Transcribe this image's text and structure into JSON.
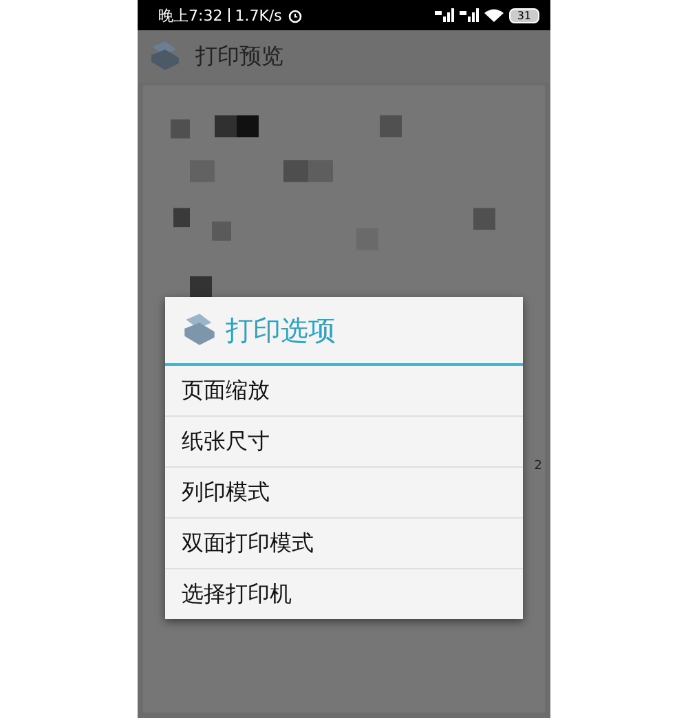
{
  "status_bar": {
    "time": "晚上7:32",
    "speed": "1.7K/s",
    "battery": "31"
  },
  "app_bar": {
    "title": "打印预览"
  },
  "preview": {
    "kind": "picture",
    "page_number": "2"
  },
  "dialog": {
    "title": "打印选项",
    "items": [
      {
        "label": "页面缩放"
      },
      {
        "label": "纸张尺寸"
      },
      {
        "label": "列印模式"
      },
      {
        "label": "双面打印模式"
      },
      {
        "label": "选择打印机"
      }
    ]
  }
}
